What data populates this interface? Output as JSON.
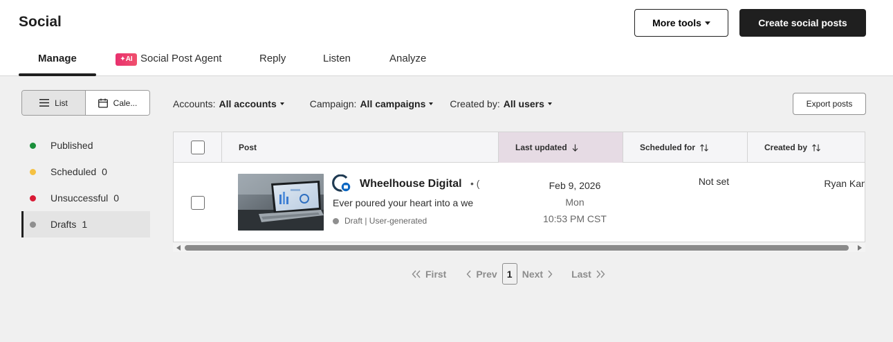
{
  "header": {
    "title": "Social",
    "more_tools_label": "More tools",
    "create_label": "Create social posts"
  },
  "tabs": [
    {
      "label": "Manage",
      "active": true
    },
    {
      "label": "Social Post Agent",
      "badge": "AI"
    },
    {
      "label": "Reply"
    },
    {
      "label": "Listen"
    },
    {
      "label": "Analyze"
    }
  ],
  "view_toggle": {
    "list_label": "List",
    "calendar_label": "Cale..."
  },
  "statuses": [
    {
      "label": "Published",
      "count": "",
      "color": "#1a8f3a"
    },
    {
      "label": "Scheduled",
      "count": "0",
      "color": "#f5c142"
    },
    {
      "label": "Unsuccessful",
      "count": "0",
      "color": "#d91a35"
    },
    {
      "label": "Drafts",
      "count": "1",
      "color": "#8f8f8f",
      "active": true
    }
  ],
  "filters": {
    "accounts_label": "Accounts:",
    "accounts_value": "All accounts",
    "campaign_label": "Campaign:",
    "campaign_value": "All campaigns",
    "created_by_label": "Created by:",
    "created_by_value": "All users"
  },
  "export_label": "Export posts",
  "table": {
    "columns": {
      "post": "Post",
      "last_updated": "Last updated",
      "scheduled_for": "Scheduled for",
      "created_by": "Created by"
    },
    "rows": [
      {
        "account": "Wheelhouse Digital",
        "account_more": "• (",
        "text": "Ever poured your heart into a we",
        "status": "Draft | User-generated",
        "updated_date": "Feb 9, 2026",
        "updated_day": "Mon",
        "updated_time": "10:53 PM CST",
        "scheduled": "Not set",
        "creator": "Ryan Kane"
      }
    ]
  },
  "pagination": {
    "first": "First",
    "prev": "Prev",
    "current": "1",
    "next": "Next",
    "last": "Last"
  },
  "colors": {
    "accent_dark": "#1f1f1f",
    "ai_badge": "#e8306e",
    "sorted_column": "#e6dbe4"
  }
}
